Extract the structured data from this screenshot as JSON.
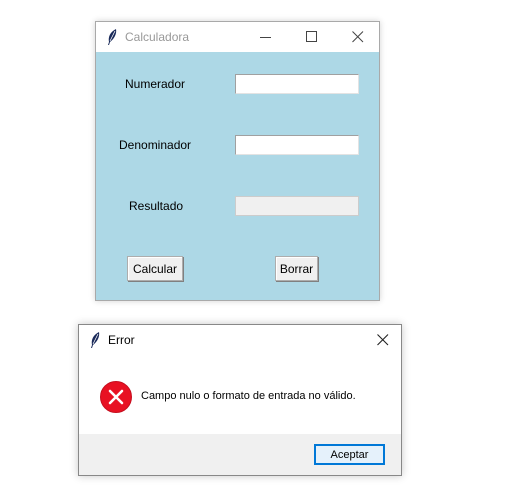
{
  "main_window": {
    "title": "Calculadora",
    "background": "#add8e6",
    "fields": {
      "numerador_label": "Numerador",
      "numerador_value": "",
      "denominador_label": "Denominador",
      "denominador_value": "",
      "resultado_label": "Resultado",
      "resultado_value": ""
    },
    "buttons": {
      "calcular": "Calcular",
      "borrar": "Borrar"
    }
  },
  "error_dialog": {
    "title": "Error",
    "icon": "error-icon",
    "message": "Campo nulo o formato de entrada no válido.",
    "ok_label": "Aceptar",
    "accent": "#0078d7"
  }
}
